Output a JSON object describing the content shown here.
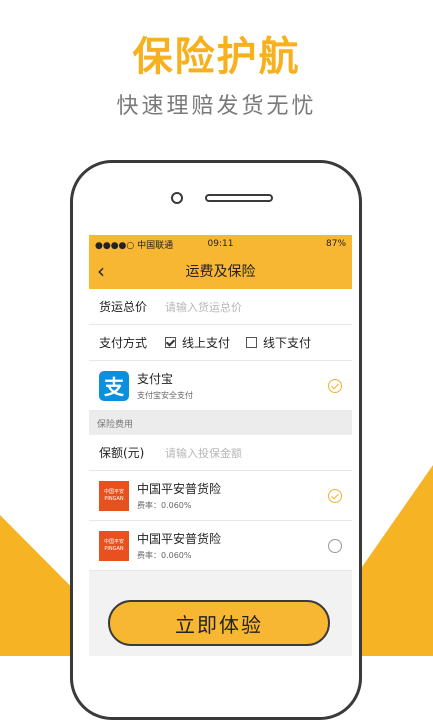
{
  "promo": {
    "title": "保险护航",
    "subtitle": "快速理赔发货无忧"
  },
  "statusbar": {
    "carrier": "●●●●○ 中国联通",
    "time": "09:11",
    "battery": "87%"
  },
  "navbar": {
    "back": "‹",
    "title": "运费及保险"
  },
  "form": {
    "cargo_label": "货运总价",
    "cargo_placeholder": "请输入货运总价",
    "pay_label": "支付方式",
    "pay_online": "线上支付",
    "pay_offline": "线下支付",
    "pay_online_checked": true,
    "pay_offline_checked": false
  },
  "alipay": {
    "icon_text": "支",
    "name": "支付宝",
    "desc": "支付宝安全支付"
  },
  "insurance": {
    "section_title": "保险费用",
    "amount_label": "保额(元)",
    "amount_placeholder": "请输入投保金额",
    "items": [
      {
        "logo": "中国平安",
        "logo_en": "PINGAN",
        "name": "中国平安普货险",
        "rate": "费率：0.060%",
        "selected": true
      },
      {
        "logo": "中国平安",
        "logo_en": "PINGAN",
        "name": "中国平安普货险",
        "rate": "费率：0.060%",
        "selected": false
      }
    ]
  },
  "cta": {
    "label": "立即体验"
  },
  "colors": {
    "accent": "#f8b732",
    "title": "#f7b11f"
  }
}
